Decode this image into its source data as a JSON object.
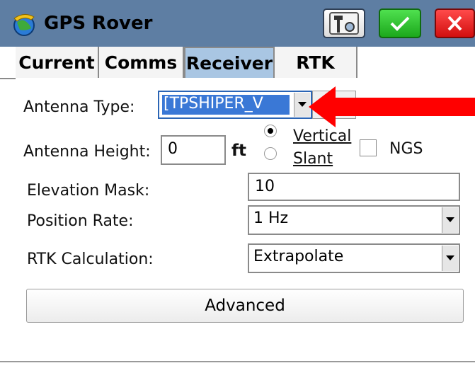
{
  "window": {
    "title": "GPS Rover",
    "icons": [
      "globe-icon",
      "tool-icon",
      "check-icon",
      "close-icon"
    ],
    "colors": {
      "titlebar": "#5e7ea3",
      "ok": "#1ca81c",
      "close": "#d20f0f",
      "active_tab": "#a9c6e3"
    }
  },
  "tabs": [
    {
      "label": "Current"
    },
    {
      "label": "Comms"
    },
    {
      "label": "Receiver",
      "active": true
    },
    {
      "label": "RTK"
    }
  ],
  "receiver": {
    "antenna_type_label": "Antenna Type:",
    "antenna_type_value": "[TPSHIPER_V",
    "antenna_height_label": "Antenna Height:",
    "antenna_height_value": "0",
    "antenna_height_unit": "ft",
    "vertical_label": "Vertical",
    "slant_label": "Slant",
    "measure_method": "Vertical",
    "ngs_label": "NGS",
    "ngs_checked": false,
    "elevation_mask_label": "Elevation Mask:",
    "elevation_mask_value": "10",
    "position_rate_label": "Position Rate:",
    "position_rate_value": "1 Hz",
    "rtk_calc_label": "RTK Calculation:",
    "rtk_calc_value": "Extrapolate",
    "advanced_label": "Advanced"
  }
}
